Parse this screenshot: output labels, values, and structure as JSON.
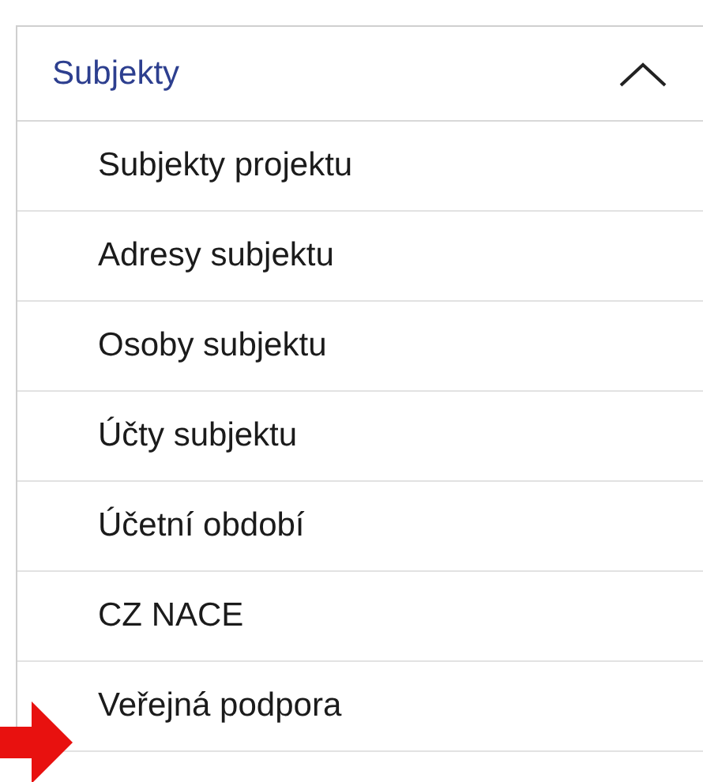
{
  "section": {
    "title": "Subjekty",
    "expanded": true
  },
  "items": [
    {
      "label": "Subjekty projektu"
    },
    {
      "label": "Adresy subjektu"
    },
    {
      "label": "Osoby subjektu"
    },
    {
      "label": "Účty subjektu"
    },
    {
      "label": "Účetní období"
    },
    {
      "label": "CZ NACE"
    },
    {
      "label": "Veřejná podpora"
    }
  ]
}
